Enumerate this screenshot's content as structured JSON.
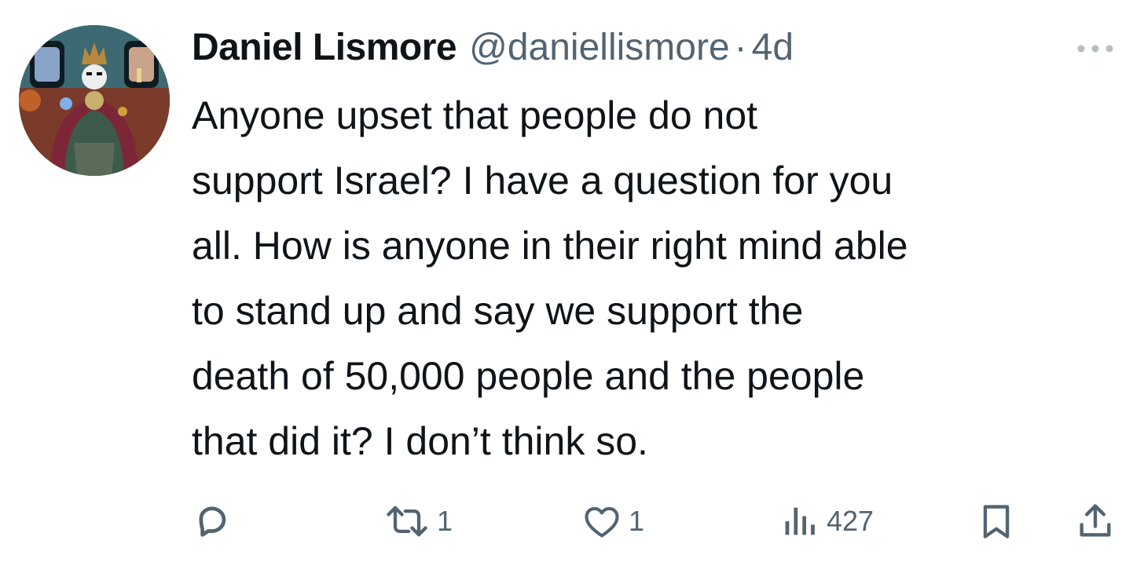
{
  "tweet": {
    "author": {
      "display_name": "Daniel Lismore",
      "handle": "@daniellismore",
      "avatar_icon": "avatar-icon"
    },
    "separator": "·",
    "timestamp": "4d",
    "text": "Anyone upset that people do not\nsupport Israel? I have a question for you\nall. How is anyone in their right mind able\nto stand up and say we support the\ndeath of 50,000 people and the people\nthat did it? I don’t think so.",
    "actions": {
      "reply": {
        "icon": "reply-icon",
        "count": ""
      },
      "retweet": {
        "icon": "retweet-icon",
        "count": "1"
      },
      "like": {
        "icon": "heart-icon",
        "count": "1"
      },
      "views": {
        "icon": "views-icon",
        "count": "427"
      },
      "bookmark": {
        "icon": "bookmark-icon"
      },
      "share": {
        "icon": "share-icon"
      }
    }
  },
  "colors": {
    "text_primary": "#0f1419",
    "text_secondary": "#536471",
    "background": "#ffffff"
  }
}
